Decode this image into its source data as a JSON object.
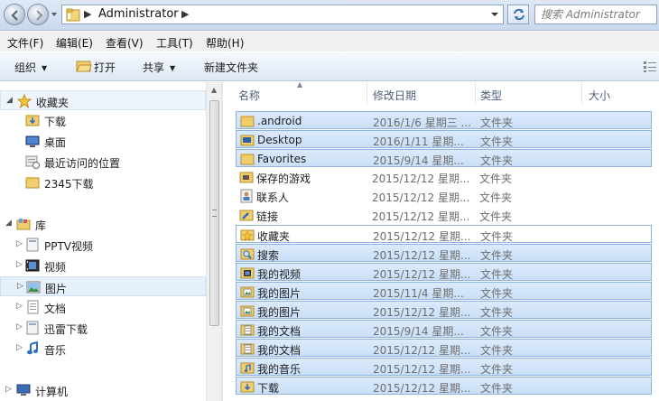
{
  "address": {
    "path": "Administrator",
    "search_placeholder": "搜索 Administrator"
  },
  "menu": [
    "文件(F)",
    "编辑(E)",
    "查看(V)",
    "工具(T)",
    "帮助(H)"
  ],
  "toolbar": {
    "organize": "组织",
    "open": "打开",
    "share": "共享",
    "new_folder": "新建文件夹"
  },
  "navigation": {
    "favorites": {
      "label": "收藏夹",
      "items": [
        "下载",
        "桌面",
        "最近访问的位置",
        "2345下载"
      ]
    },
    "libraries": {
      "label": "库",
      "items": [
        "PPTV视频",
        "视频",
        "图片",
        "文档",
        "迅雷下载",
        "音乐"
      ]
    },
    "computer": {
      "label": "计算机"
    }
  },
  "columns": {
    "name": "名称",
    "date": "修改日期",
    "type": "类型",
    "size": "大小"
  },
  "files": [
    {
      "name": ".android",
      "date": "2016/1/6 星期三 ...",
      "type": "文件夹",
      "icon": "folder-icon"
    },
    {
      "name": "Desktop",
      "date": "2016/1/11 星期...",
      "type": "文件夹",
      "icon": "desktop-folder-icon"
    },
    {
      "name": "Favorites",
      "date": "2015/9/14 星期...",
      "type": "文件夹",
      "icon": "folder-icon"
    },
    {
      "name": "保存的游戏",
      "date": "2015/12/12 星期...",
      "type": "文件夹",
      "icon": "saved-games-icon"
    },
    {
      "name": "联系人",
      "date": "2015/12/12 星期...",
      "type": "文件夹",
      "icon": "contacts-icon"
    },
    {
      "name": "链接",
      "date": "2015/12/12 星期...",
      "type": "文件夹",
      "icon": "links-icon"
    },
    {
      "name": "收藏夹",
      "date": "2015/12/12 星期...",
      "type": "文件夹",
      "icon": "favorites-folder-icon"
    },
    {
      "name": "搜索",
      "date": "2015/12/12 星期...",
      "type": "文件夹",
      "icon": "searches-folder-icon"
    },
    {
      "name": "我的视频",
      "date": "2015/12/12 星期...",
      "type": "文件夹",
      "icon": "videos-folder-icon"
    },
    {
      "name": "我的图片",
      "date": "2015/11/4 星期...",
      "type": "文件夹",
      "icon": "pictures-folder-icon"
    },
    {
      "name": "我的图片",
      "date": "2015/12/12 星期...",
      "type": "文件夹",
      "icon": "pictures-folder-icon"
    },
    {
      "name": "我的文档",
      "date": "2015/9/14 星期...",
      "type": "文件夹",
      "icon": "documents-folder-icon"
    },
    {
      "name": "我的文档",
      "date": "2015/12/12 星期...",
      "type": "文件夹",
      "icon": "documents-folder-icon"
    },
    {
      "name": "我的音乐",
      "date": "2015/12/12 星期...",
      "type": "文件夹",
      "icon": "music-folder-icon"
    },
    {
      "name": "下载",
      "date": "2015/12/12 星期...",
      "type": "文件夹",
      "icon": "downloads-folder-icon"
    }
  ],
  "colors": {
    "selection_fill": "#c9dff8",
    "selection_border": "#8fb3de",
    "header_text": "#4c607a",
    "folder": "#e8c05a"
  }
}
